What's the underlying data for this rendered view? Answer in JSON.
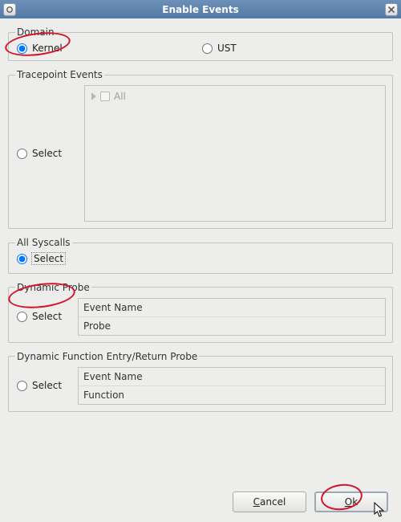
{
  "window": {
    "title": "Enable Events"
  },
  "domain": {
    "legend": "Domain",
    "options": [
      {
        "label": "Kernel",
        "selected": true
      },
      {
        "label": "UST",
        "selected": false
      }
    ]
  },
  "tracepoint": {
    "legend": "Tracepoint Events",
    "select_label": "Select",
    "select_selected": false,
    "tree_root_label": "All"
  },
  "syscalls": {
    "legend": "All Syscalls",
    "select_label": "Select",
    "select_selected": true
  },
  "dyn_probe": {
    "legend": "Dynamic Probe",
    "select_label": "Select",
    "select_selected": false,
    "fields": [
      {
        "label": "Event Name"
      },
      {
        "label": "Probe"
      }
    ]
  },
  "dyn_func": {
    "legend": "Dynamic Function Entry/Return Probe",
    "select_label": "Select",
    "select_selected": false,
    "fields": [
      {
        "label": "Event Name"
      },
      {
        "label": "Function"
      }
    ]
  },
  "buttons": {
    "cancel": "Cancel",
    "ok": "Ok"
  }
}
